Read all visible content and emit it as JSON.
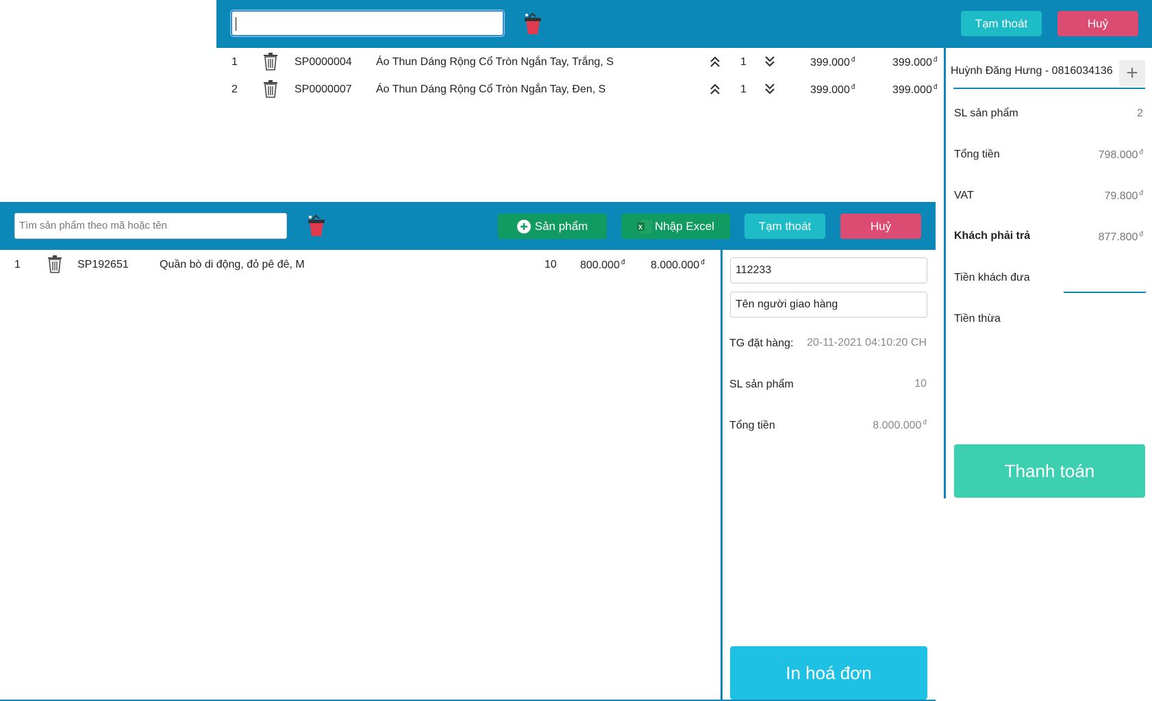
{
  "top": {
    "search_value": "",
    "suspend_label": "Tạm thoát",
    "cancel_label": "Huỷ",
    "rows": [
      {
        "index": "1",
        "code": "SP0000004",
        "name": "Áo Thun Dáng Rộng Cổ Tròn Ngắn Tay, Trắng, S",
        "qty": "1",
        "price": "399.000",
        "total": "399.000"
      },
      {
        "index": "2",
        "code": "SP0000007",
        "name": "Áo Thun Dáng Rộng Cổ Tròn Ngắn Tay, Đen, S",
        "qty": "1",
        "price": "399.000",
        "total": "399.000"
      }
    ],
    "currency": "đ"
  },
  "right_panel": {
    "customer": "Huỳnh Đăng Hưng - 0816034136",
    "qty_label": "SL sản phẩm",
    "qty_value": "2",
    "total_label": "Tổng tiền",
    "total_value": "798.000",
    "vat_label": "VAT",
    "vat_value": "79.800",
    "pay_label": "Khách phải trả",
    "pay_value": "877.800",
    "cash_label": "Tiền khách đưa",
    "change_label": "Tiền thừa",
    "checkout_label": "Thanh toán"
  },
  "bottom": {
    "search_placeholder": "Tìm sản phẩm theo mã hoặc tên",
    "add_product_label": "Sản phẩm",
    "import_excel_label": "Nhập Excel",
    "suspend_label": "Tạm thoát",
    "cancel_label": "Huỷ",
    "rows": [
      {
        "index": "1",
        "code": "SP192651",
        "name": "Quần bò di động, đỏ pê đê, M",
        "qty": "10",
        "price": "800.000",
        "total": "8.000.000"
      }
    ],
    "order_code": "112233",
    "shipper_placeholder": "Tên người giao hàng",
    "order_time_label": "TG đặt hàng:",
    "order_time_value": "20-11-2021 04:10:20 CH",
    "qty_label": "SL sản phẩm",
    "qty_value": "10",
    "total_label": "Tổng tiền",
    "total_value": "8.000.000",
    "print_label": "In hoá đơn"
  },
  "colors": {
    "header_blue": "#0b87b8",
    "teal_button": "#1dbcc6",
    "pink_button": "#dc4c72",
    "green_button": "#129a63",
    "checkout_green": "#3ccfb0",
    "print_blue": "#1ec1e4"
  },
  "icons": [
    "cart-remove-icon",
    "trash-icon",
    "chevron-double-up-icon",
    "chevron-double-down-icon",
    "plus-icon",
    "excel-icon"
  ]
}
